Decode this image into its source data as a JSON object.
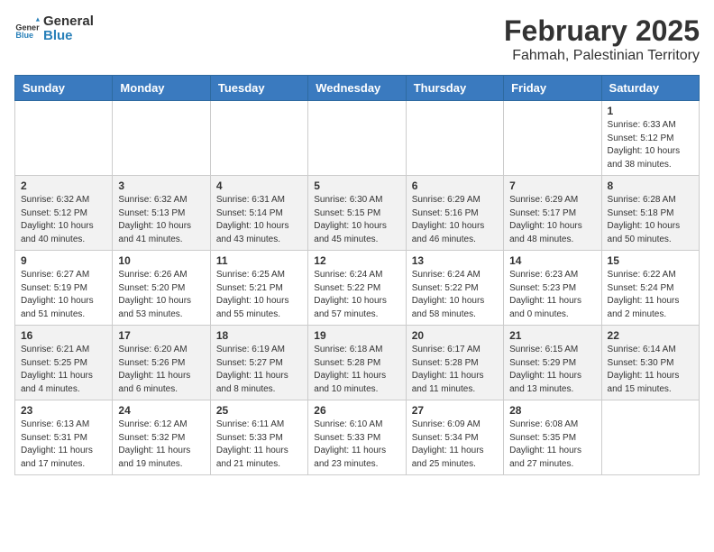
{
  "header": {
    "logo_general": "General",
    "logo_blue": "Blue",
    "main_title": "February 2025",
    "sub_title": "Fahmah, Palestinian Territory"
  },
  "days_of_week": [
    "Sunday",
    "Monday",
    "Tuesday",
    "Wednesday",
    "Thursday",
    "Friday",
    "Saturday"
  ],
  "weeks": [
    [
      {
        "day": "",
        "detail": ""
      },
      {
        "day": "",
        "detail": ""
      },
      {
        "day": "",
        "detail": ""
      },
      {
        "day": "",
        "detail": ""
      },
      {
        "day": "",
        "detail": ""
      },
      {
        "day": "",
        "detail": ""
      },
      {
        "day": "1",
        "detail": "Sunrise: 6:33 AM\nSunset: 5:12 PM\nDaylight: 10 hours and 38 minutes."
      }
    ],
    [
      {
        "day": "2",
        "detail": "Sunrise: 6:32 AM\nSunset: 5:12 PM\nDaylight: 10 hours and 40 minutes."
      },
      {
        "day": "3",
        "detail": "Sunrise: 6:32 AM\nSunset: 5:13 PM\nDaylight: 10 hours and 41 minutes."
      },
      {
        "day": "4",
        "detail": "Sunrise: 6:31 AM\nSunset: 5:14 PM\nDaylight: 10 hours and 43 minutes."
      },
      {
        "day": "5",
        "detail": "Sunrise: 6:30 AM\nSunset: 5:15 PM\nDaylight: 10 hours and 45 minutes."
      },
      {
        "day": "6",
        "detail": "Sunrise: 6:29 AM\nSunset: 5:16 PM\nDaylight: 10 hours and 46 minutes."
      },
      {
        "day": "7",
        "detail": "Sunrise: 6:29 AM\nSunset: 5:17 PM\nDaylight: 10 hours and 48 minutes."
      },
      {
        "day": "8",
        "detail": "Sunrise: 6:28 AM\nSunset: 5:18 PM\nDaylight: 10 hours and 50 minutes."
      }
    ],
    [
      {
        "day": "9",
        "detail": "Sunrise: 6:27 AM\nSunset: 5:19 PM\nDaylight: 10 hours and 51 minutes."
      },
      {
        "day": "10",
        "detail": "Sunrise: 6:26 AM\nSunset: 5:20 PM\nDaylight: 10 hours and 53 minutes."
      },
      {
        "day": "11",
        "detail": "Sunrise: 6:25 AM\nSunset: 5:21 PM\nDaylight: 10 hours and 55 minutes."
      },
      {
        "day": "12",
        "detail": "Sunrise: 6:24 AM\nSunset: 5:22 PM\nDaylight: 10 hours and 57 minutes."
      },
      {
        "day": "13",
        "detail": "Sunrise: 6:24 AM\nSunset: 5:22 PM\nDaylight: 10 hours and 58 minutes."
      },
      {
        "day": "14",
        "detail": "Sunrise: 6:23 AM\nSunset: 5:23 PM\nDaylight: 11 hours and 0 minutes."
      },
      {
        "day": "15",
        "detail": "Sunrise: 6:22 AM\nSunset: 5:24 PM\nDaylight: 11 hours and 2 minutes."
      }
    ],
    [
      {
        "day": "16",
        "detail": "Sunrise: 6:21 AM\nSunset: 5:25 PM\nDaylight: 11 hours and 4 minutes."
      },
      {
        "day": "17",
        "detail": "Sunrise: 6:20 AM\nSunset: 5:26 PM\nDaylight: 11 hours and 6 minutes."
      },
      {
        "day": "18",
        "detail": "Sunrise: 6:19 AM\nSunset: 5:27 PM\nDaylight: 11 hours and 8 minutes."
      },
      {
        "day": "19",
        "detail": "Sunrise: 6:18 AM\nSunset: 5:28 PM\nDaylight: 11 hours and 10 minutes."
      },
      {
        "day": "20",
        "detail": "Sunrise: 6:17 AM\nSunset: 5:28 PM\nDaylight: 11 hours and 11 minutes."
      },
      {
        "day": "21",
        "detail": "Sunrise: 6:15 AM\nSunset: 5:29 PM\nDaylight: 11 hours and 13 minutes."
      },
      {
        "day": "22",
        "detail": "Sunrise: 6:14 AM\nSunset: 5:30 PM\nDaylight: 11 hours and 15 minutes."
      }
    ],
    [
      {
        "day": "23",
        "detail": "Sunrise: 6:13 AM\nSunset: 5:31 PM\nDaylight: 11 hours and 17 minutes."
      },
      {
        "day": "24",
        "detail": "Sunrise: 6:12 AM\nSunset: 5:32 PM\nDaylight: 11 hours and 19 minutes."
      },
      {
        "day": "25",
        "detail": "Sunrise: 6:11 AM\nSunset: 5:33 PM\nDaylight: 11 hours and 21 minutes."
      },
      {
        "day": "26",
        "detail": "Sunrise: 6:10 AM\nSunset: 5:33 PM\nDaylight: 11 hours and 23 minutes."
      },
      {
        "day": "27",
        "detail": "Sunrise: 6:09 AM\nSunset: 5:34 PM\nDaylight: 11 hours and 25 minutes."
      },
      {
        "day": "28",
        "detail": "Sunrise: 6:08 AM\nSunset: 5:35 PM\nDaylight: 11 hours and 27 minutes."
      },
      {
        "day": "",
        "detail": ""
      }
    ]
  ]
}
